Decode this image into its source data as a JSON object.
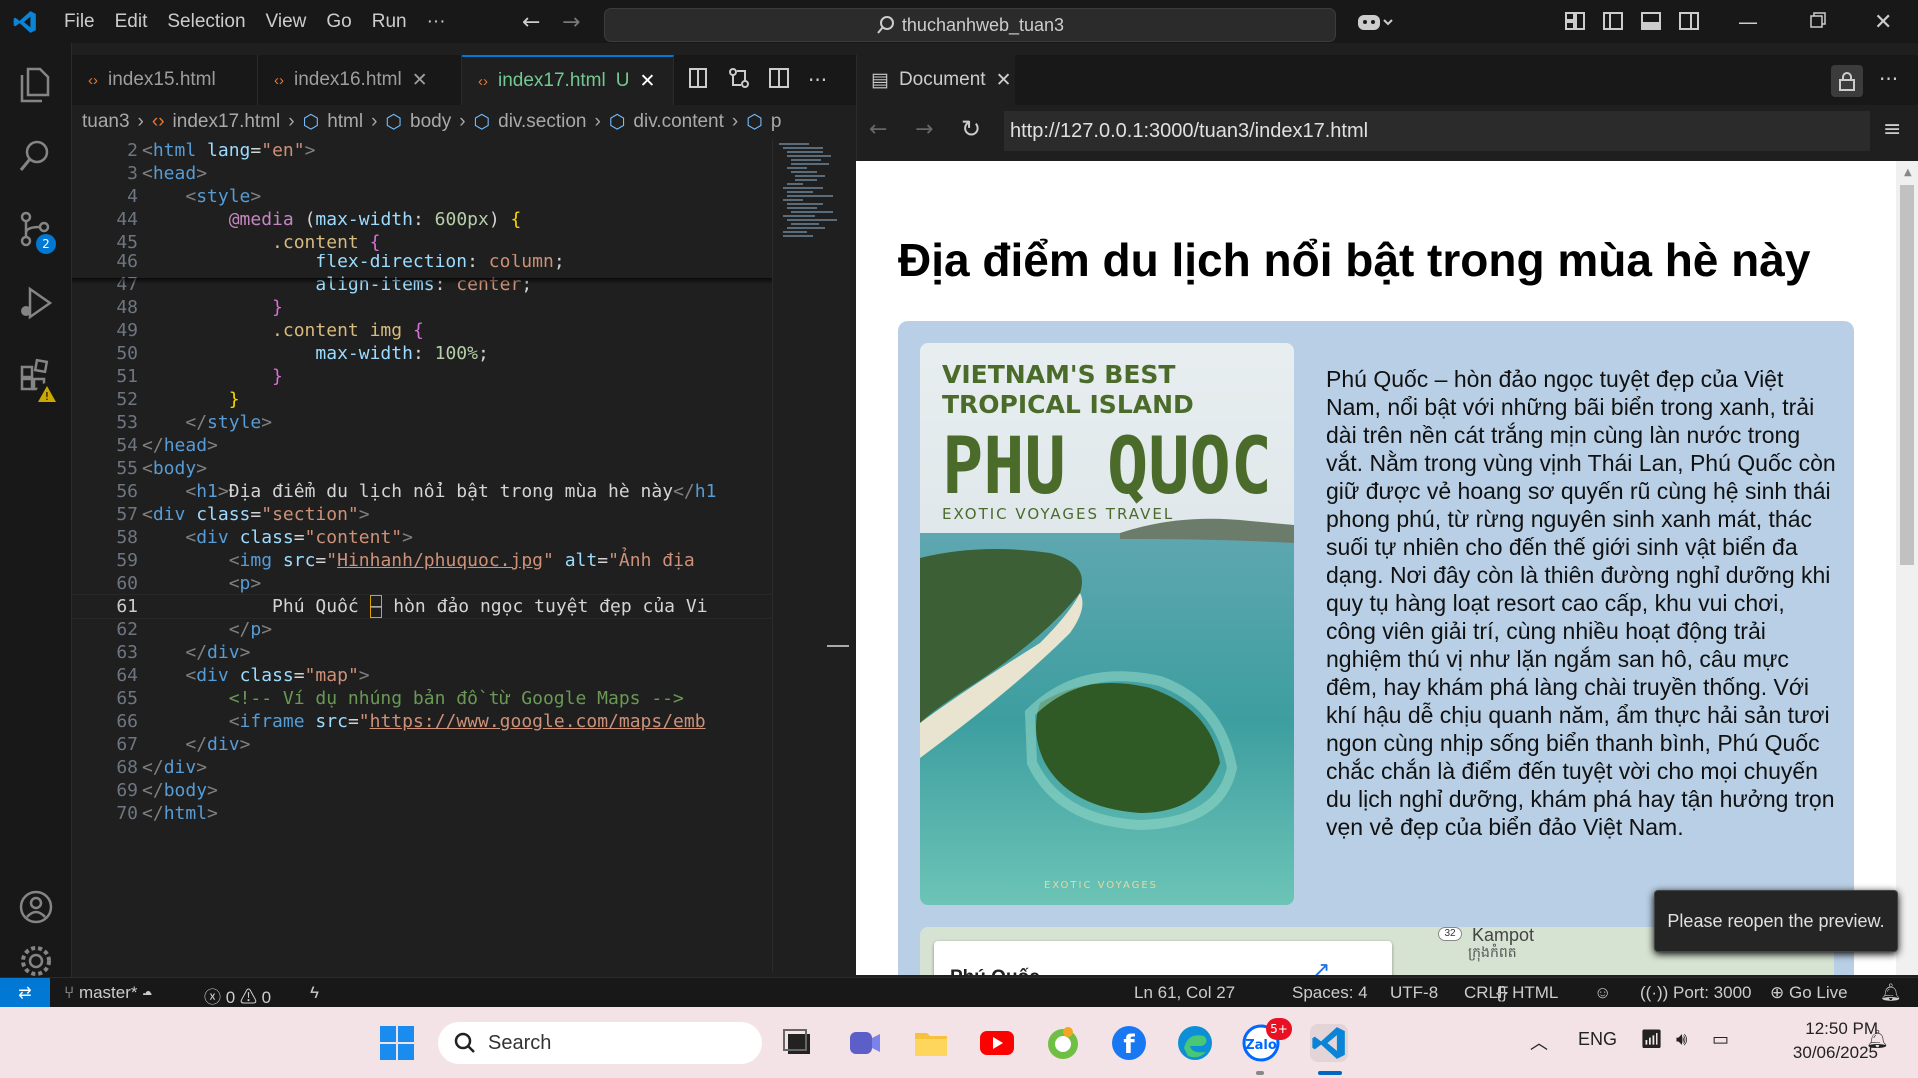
{
  "titlebar": {
    "menu": [
      "File",
      "Edit",
      "Selection",
      "View",
      "Go",
      "Run",
      "···"
    ],
    "search_text": "thuchanhweb_tuan3"
  },
  "activity": {
    "source_control_badge": "2"
  },
  "editor": {
    "tabs": [
      {
        "label": "index15.html",
        "active": false
      },
      {
        "label": "index16.html",
        "active": false
      },
      {
        "label": "index17.html",
        "active": true,
        "status": "U"
      }
    ],
    "breadcrumb": [
      "tuan3",
      "index17.html",
      "html",
      "body",
      "div.section",
      "div.content",
      "p"
    ],
    "lines": [
      {
        "n": "2",
        "html": "<span class='t-br'>&lt;</span><span class='t-tag'>html</span> <span class='t-attr'>lang</span>=<span class='t-str'>\"en\"</span><span class='t-br'>&gt;</span>"
      },
      {
        "n": "3",
        "html": "<span class='t-br'>&lt;</span><span class='t-tag'>head</span><span class='t-br'>&gt;</span>"
      },
      {
        "n": "4",
        "html": "    <span class='t-br'>&lt;</span><span class='t-tag'>style</span><span class='t-br'>&gt;</span>"
      },
      {
        "n": "44",
        "html": "        <span class='t-kw'>@media</span> (<span class='t-attr'>max-width</span>: <span class='t-num'>600px</span>) <span class='t-y'>{</span>"
      },
      {
        "n": "45",
        "html": "            <span class='t-sel'>.content</span> <span class='t-p'>{</span>"
      },
      {
        "n": "46",
        "html": "                <span class='t-attr'>flex-direction</span>: <span class='t-str'>column</span>;"
      },
      {
        "n": "47",
        "html": "                <span class='t-attr'>align-items</span>: <span class='t-str'>center</span>;"
      },
      {
        "n": "48",
        "html": "            <span class='t-p'>}</span>"
      },
      {
        "n": "49",
        "html": "            <span class='t-sel'>.content img</span> <span class='t-p'>{</span>"
      },
      {
        "n": "50",
        "html": "                <span class='t-attr'>max-width</span>: <span class='t-num'>100%</span>;"
      },
      {
        "n": "51",
        "html": "            <span class='t-p'>}</span>"
      },
      {
        "n": "52",
        "html": "        <span class='t-y'>}</span>"
      },
      {
        "n": "53",
        "html": "    <span class='t-br'>&lt;/</span><span class='t-tag'>style</span><span class='t-br'>&gt;</span>"
      },
      {
        "n": "54",
        "html": "<span class='t-br'>&lt;/</span><span class='t-tag'>head</span><span class='t-br'>&gt;</span>"
      },
      {
        "n": "55",
        "html": "<span class='t-br'>&lt;</span><span class='t-tag'>body</span><span class='t-br'>&gt;</span>"
      },
      {
        "n": "56",
        "html": "    <span class='t-br'>&lt;</span><span class='t-tag'>h1</span><span class='t-br'>&gt;</span>Địa điểm du lịch nổi bật trong mùa hè này<span class='t-br'>&lt;/</span><span class='t-tag'>h1</span>"
      },
      {
        "n": "57",
        "html": "<span class='t-br'>&lt;</span><span class='t-tag'>div</span> <span class='t-attr'>class</span>=<span class='t-str'>\"section\"</span><span class='t-br'>&gt;</span>"
      },
      {
        "n": "58",
        "html": "    <span class='t-br'>&lt;</span><span class='t-tag'>div</span> <span class='t-attr'>class</span>=<span class='t-str'>\"content\"</span><span class='t-br'>&gt;</span>"
      },
      {
        "n": "59",
        "html": "        <span class='t-br'>&lt;</span><span class='t-tag'>img</span> <span class='t-attr'>src</span>=<span class='t-str'>\"<u>Hinhanh/phuquoc.jpg</u>\"</span> <span class='t-attr'>alt</span>=<span class='t-str'>\"Ảnh địa</span>"
      },
      {
        "n": "60",
        "html": "        <span class='t-br'>&lt;</span><span class='t-tag'>p</span><span class='t-br'>&gt;</span>"
      },
      {
        "n": "61",
        "html": "            Phú Quốc <span style='border:1px solid #e0a000'>–</span> hòn đảo ngọc tuyệt đẹp của Vi"
      },
      {
        "n": "62",
        "html": "        <span class='t-br'>&lt;/</span><span class='t-tag'>p</span><span class='t-br'>&gt;</span>"
      },
      {
        "n": "63",
        "html": "    <span class='t-br'>&lt;/</span><span class='t-tag'>div</span><span class='t-br'>&gt;</span>"
      },
      {
        "n": "64",
        "html": "    <span class='t-br'>&lt;</span><span class='t-tag'>div</span> <span class='t-attr'>class</span>=<span class='t-str'>\"map\"</span><span class='t-br'>&gt;</span>"
      },
      {
        "n": "65",
        "html": "        <span class='t-cm'>&lt;!-- Ví dụ nhúng bản đồ từ Google Maps --&gt;</span>"
      },
      {
        "n": "66",
        "html": "        <span class='t-br'>&lt;</span><span class='t-tag'>iframe</span> <span class='t-attr'>src</span>=<span class='t-str'>\"<u>https://www.google.com/maps/emb</u></span>"
      },
      {
        "n": "67",
        "html": "    <span class='t-br'>&lt;/</span><span class='t-tag'>div</span><span class='t-br'>&gt;</span>"
      },
      {
        "n": "68",
        "html": "<span class='t-br'>&lt;/</span><span class='t-tag'>div</span><span class='t-br'>&gt;</span>"
      },
      {
        "n": "69",
        "html": "<span class='t-br'>&lt;/</span><span class='t-tag'>body</span><span class='t-br'>&gt;</span>"
      },
      {
        "n": "70",
        "html": "<span class='t-br'>&lt;/</span><span class='t-tag'>html</span><span class='t-br'>&gt;</span>"
      }
    ]
  },
  "preview": {
    "tab_label": "Document",
    "url": "http://127.0.0.1:3000/tuan3/index17.html",
    "heading": "Địa điểm du lịch nổi bật trong mùa hè này",
    "poster": {
      "line1": "VIETNAM'S BEST",
      "line2": "TROPICAL ISLAND",
      "title": "PHU QUOC",
      "subtitle": "EXOTIC VOYAGES TRAVEL",
      "footer": "EXOTIC VOYAGES"
    },
    "paragraph": "Phú Quốc – hòn đảo ngọc tuyệt đẹp của Việt Nam, nổi bật với những bãi biển trong xanh, trải dài trên nền cát trắng mịn cùng làn nước trong vắt. Nằm trong vùng vịnh Thái Lan, Phú Quốc còn giữ được vẻ hoang sơ quyến rũ cùng hệ sinh thái phong phú, từ rừng nguyên sinh xanh mát, thác suối tự nhiên cho đến thế giới sinh vật biển đa dạng. Nơi đây còn là thiên đường nghỉ dưỡng khi quy tụ hàng loạt resort cao cấp, khu vui chơi, công viên giải trí, cùng nhiều hoạt động trải nghiệm thú vị như lặn ngắm san hô, câu mực đêm, hay khám phá làng chài truyền thống. Với khí hậu dễ chịu quanh năm, ẩm thực hải sản tươi ngon cùng nhịp sống biển thanh bình, Phú Quốc chắc chắn là điểm đến tuyệt vời cho mọi chuyến du lịch nghỉ dưỡng, khám phá hay tận hưởng trọn vẹn vẻ đẹp của biển đảo Việt Nam.",
    "map": {
      "place_label": "Phú Quốc",
      "town": "Kampot",
      "town_khmer": "ក្រុងកំពត",
      "road": "32"
    },
    "toast": "Please reopen the preview."
  },
  "statusbar": {
    "branch": "master*",
    "errors": "0",
    "warnings": "0",
    "position": "Ln 61, Col 27",
    "spaces": "Spaces: 4",
    "encoding": "UTF-8",
    "eol": "CRLF",
    "language": "HTML",
    "port": "Port: 3000",
    "golive": "Go Live"
  },
  "taskbar": {
    "search_placeholder": "Search",
    "zalo_badge": "5+",
    "lang": "ENG",
    "time": "12:50 PM",
    "date": "30/06/2025"
  },
  "colors": {
    "accent": "#0078d4",
    "section_bg": "#b8cfe5",
    "poster_green": "#4a6b2a"
  }
}
